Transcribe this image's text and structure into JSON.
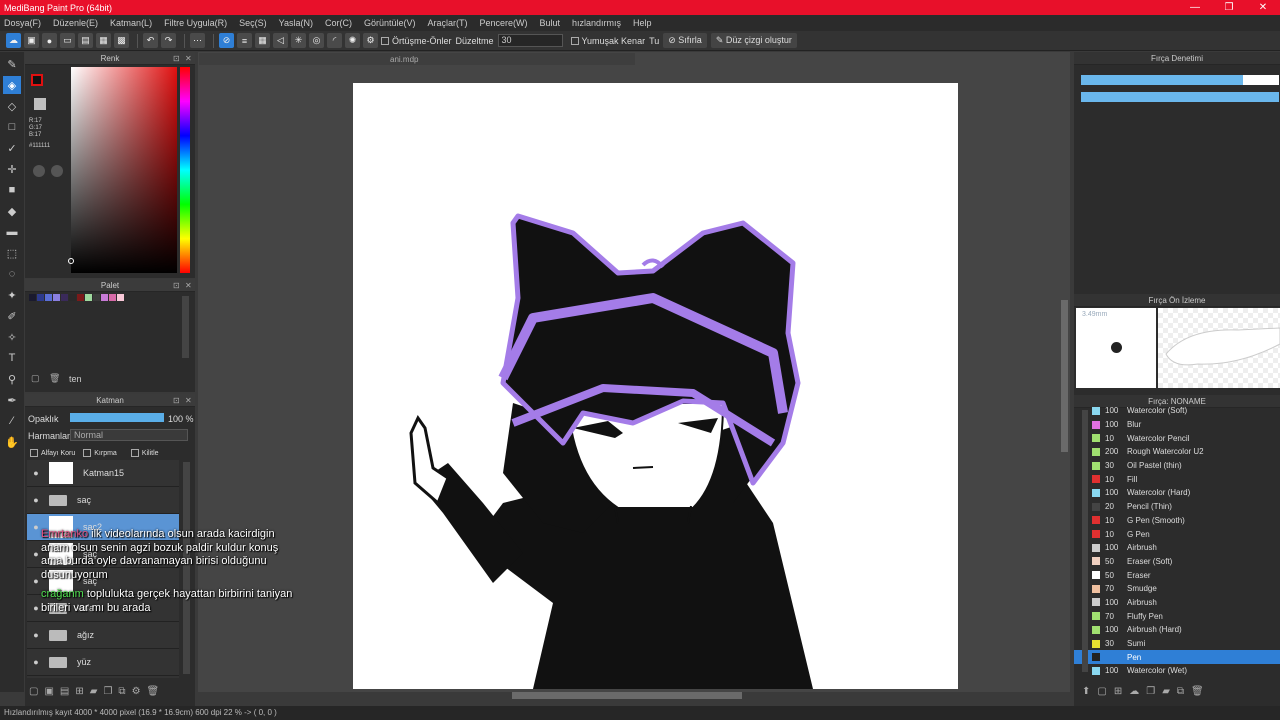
{
  "app": {
    "title": "MediBang Paint Pro (64bit)",
    "min": "—",
    "restore": "❐",
    "close": "✕"
  },
  "menu": [
    "Dosya(F)",
    "Düzenle(E)",
    "Katman(L)",
    "Filtre Uygula(R)",
    "Seç(S)",
    "Yasla(N)",
    "Cor(C)",
    "Görüntüle(V)",
    "Araçlar(T)",
    "Pencere(W)",
    "Bulut",
    "hızlandırmış",
    "Help"
  ],
  "toolbar": {
    "overlap": "Örtüşme-Önler",
    "correction_label": "Düzeltme",
    "correction_value": "30",
    "soft_edge": "Yumuşak Kenar",
    "tu": "Tu",
    "reset": "Sıfırla",
    "straight": "Düz çizgi oluştur"
  },
  "color_panel": {
    "title": "Renk",
    "r": "R:17",
    "g": "G:17",
    "b": "B:17",
    "hex": "#111111",
    "fg_color": "#111111"
  },
  "palette_panel": {
    "title": "Palet",
    "swatches": [
      "#1a1a2e",
      "#2d3a8c",
      "#5b6fd6",
      "#8a7fe0",
      "#3a2a5a",
      "#2a2a2a",
      "#7a1a1a",
      "#9ed99e",
      "#3a3a3a",
      "#c77ad6",
      "#d86aa8",
      "#f8c8d8"
    ],
    "name": "ten"
  },
  "layer_panel": {
    "title": "Katman",
    "opacity_label": "Opaklık",
    "opacity_value": "100 %",
    "opacity_fraction": 1.0,
    "blend_label": "Harmanlama",
    "blend_value": "Normal",
    "alpha_lock": "Alfayı Koru",
    "clip": "Kırpma",
    "lock": "Kilitle",
    "layers": [
      {
        "name": "Katman15",
        "type": "layer"
      },
      {
        "name": "saç",
        "type": "folder"
      },
      {
        "name": "saç2",
        "type": "layer",
        "selected": true
      },
      {
        "name": "saç",
        "type": "layer"
      },
      {
        "name": "saç",
        "type": "layer"
      },
      {
        "name": "kafa",
        "type": "folder"
      },
      {
        "name": "ağız",
        "type": "folder"
      },
      {
        "name": "yüz",
        "type": "folder"
      }
    ]
  },
  "canvas": {
    "filename": "ani.mdp"
  },
  "brush_control": {
    "title": "Fırça Denetimi",
    "bar1_fraction": 0.82,
    "bar2_fraction": 1.0
  },
  "brush_preview": {
    "title": "Fırça Ön İzleme",
    "size": "3.49mm"
  },
  "brush_list": {
    "title": "Fırça: NONAME",
    "items": [
      {
        "size": "100",
        "name": "Watercolor (Soft)",
        "color": "#8ad8f0"
      },
      {
        "size": "100",
        "name": "Blur",
        "color": "#e070e0"
      },
      {
        "size": "10",
        "name": "Watercolor Pencil",
        "color": "#a0e070"
      },
      {
        "size": "200",
        "name": "Rough Watercolor U2",
        "color": "#a0e070"
      },
      {
        "size": "30",
        "name": "Oil Pastel (thin)",
        "color": "#a0e070"
      },
      {
        "size": "10",
        "name": "Fill",
        "color": "#e03030"
      },
      {
        "size": "100",
        "name": "Watercolor (Hard)",
        "color": "#8ad8f0"
      },
      {
        "size": "20",
        "name": "Pencil (Thin)",
        "color": "#444444"
      },
      {
        "size": "10",
        "name": "G Pen (Smooth)",
        "color": "#e03030"
      },
      {
        "size": "10",
        "name": "G Pen",
        "color": "#e03030"
      },
      {
        "size": "100",
        "name": "Airbrush",
        "color": "#cccccc"
      },
      {
        "size": "50",
        "name": "Eraser (Soft)",
        "color": "#f0d0c0"
      },
      {
        "size": "50",
        "name": "Eraser",
        "color": "#ffffff"
      },
      {
        "size": "70",
        "name": "Smudge",
        "color": "#f0c0a0"
      },
      {
        "size": "100",
        "name": "Airbrush",
        "color": "#cccccc"
      },
      {
        "size": "70",
        "name": "Fluffy Pen",
        "color": "#a0e070"
      },
      {
        "size": "100",
        "name": "Airbrush (Hard)",
        "color": "#a0e070"
      },
      {
        "size": "30",
        "name": "Sumi",
        "color": "#e8e030"
      },
      {
        "size": "",
        "name": "Pen",
        "color": "#222222",
        "selected": true
      },
      {
        "size": "100",
        "name": "Watercolor (Wet)",
        "color": "#8ad8f0"
      }
    ]
  },
  "chat": [
    {
      "user": "Emrtanko",
      "text": "ilk videolarında olsun arada kacirdigin anam olsun senin agzi bozuk paldir kuldur konuş ama burda oyle davranamayan birisi olduğunu dusunuyorum",
      "user_color": "#e05080"
    },
    {
      "user": "crağanm",
      "text": "toplulukta gerçek hayattan birbirini taniyan birileri var mı bu arada",
      "user_color": "#50e050"
    }
  ],
  "status": "Hızlandırılmış kayıt   4000 * 4000 pixel  (16.9 * 16.9cm)  600 dpi  22 %  -> ( 0, 0 )"
}
